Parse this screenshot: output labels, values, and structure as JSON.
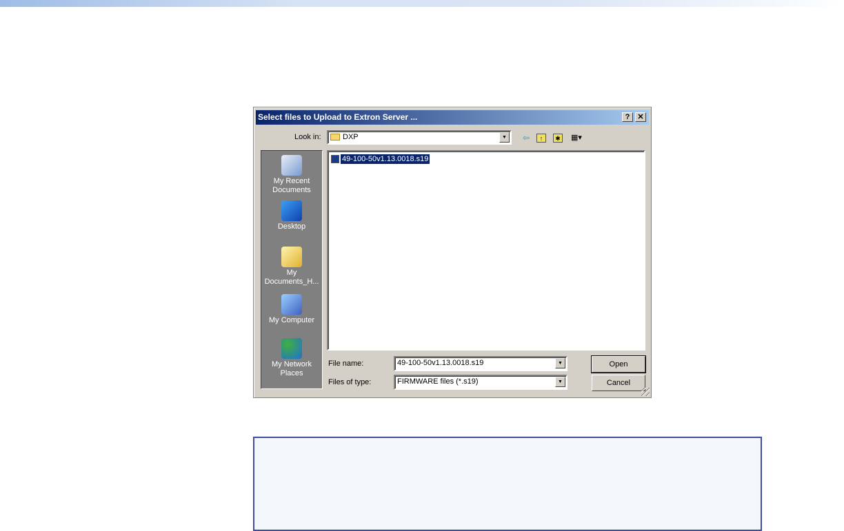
{
  "dialog": {
    "title": "Select files to Upload to Extron Server ...",
    "help_label": "?",
    "close_label": "✕",
    "look_in_label": "Look in:",
    "look_in_value": "DXP",
    "places": [
      {
        "label": "My Recent Documents",
        "icon": "recent-documents-icon"
      },
      {
        "label": "Desktop",
        "icon": "desktop-icon"
      },
      {
        "label": "My Documents_H...",
        "icon": "my-documents-icon"
      },
      {
        "label": "My Computer",
        "icon": "my-computer-icon"
      },
      {
        "label": "My Network Places",
        "icon": "network-places-icon"
      }
    ],
    "files": [
      {
        "name": "49-100-50v1.13.0018.s19",
        "selected": true
      }
    ],
    "file_name_label": "File name:",
    "file_name_value": "49-100-50v1.13.0018.s19",
    "file_type_label": "Files of type:",
    "file_type_value": "FIRMWARE files (*.s19)",
    "open_label": "Open",
    "cancel_label": "Cancel"
  },
  "colors": {
    "title_bar": "#0a246a",
    "note_border": "#3f4aa0"
  }
}
